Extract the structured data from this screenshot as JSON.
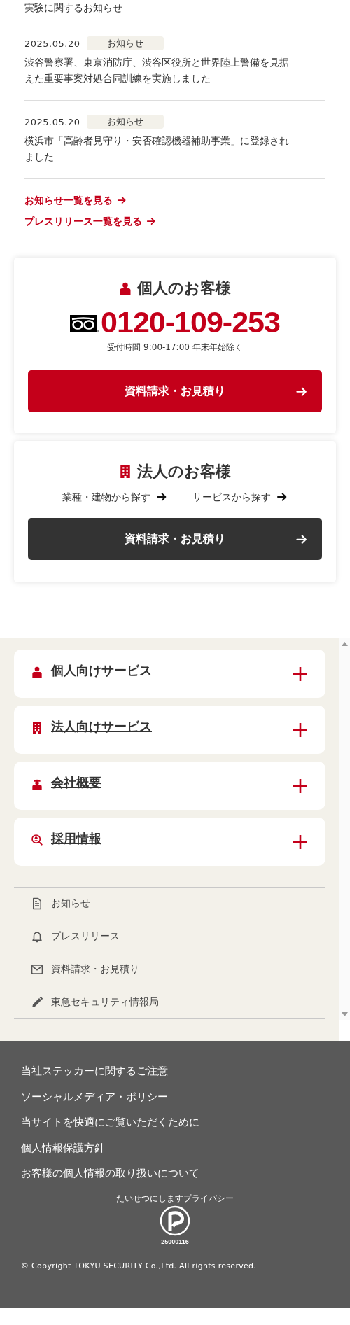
{
  "news": {
    "cut_item": "実験に関するお知らせ",
    "items": [
      {
        "date": "2025.05.20",
        "category": "お知らせ",
        "title": "渋谷警察署、東京消防庁、渋谷区役所と世界陸上警備を見据えた重要事案対処合同訓練を実施しました"
      },
      {
        "date": "2025.05.20",
        "category": "お知らせ",
        "title": "横浜市「高齢者見守り・安否確認機器補助事業」に登録されました"
      }
    ],
    "links": [
      "お知らせ一覧を見る",
      "プレスリリース一覧を見る"
    ]
  },
  "personal_contact": {
    "title": "個人のお客様",
    "phone": "0120-109-253",
    "hours": "受付時間 9:00-17:00 年末年始除く",
    "button": "資料請求・お見積り"
  },
  "corporate_contact": {
    "title": "法人のお客様",
    "links": [
      "業種・建物から探す",
      "サービスから探す"
    ],
    "button": "資料請求・お見積り"
  },
  "accordion": [
    {
      "label": "個人向けサービス",
      "kind": "person",
      "expanded": false,
      "underlined": false
    },
    {
      "label": "法人向けサービス",
      "kind": "building",
      "expanded": false,
      "underlined": true
    },
    {
      "label": "会社概要",
      "kind": "guard",
      "expanded": false,
      "underlined": true
    },
    {
      "label": "採用情報",
      "kind": "recruit",
      "expanded": false,
      "underlined": true
    }
  ],
  "nav_links": [
    {
      "label": "お知らせ",
      "kind": "document"
    },
    {
      "label": "プレスリリース",
      "kind": "bell"
    },
    {
      "label": "資料請求・お見積り",
      "kind": "mail"
    },
    {
      "label": "東急セキュリティ情報局",
      "kind": "pencil"
    }
  ],
  "footer": {
    "links": [
      "当社ステッカーに関するご注意",
      "ソーシャルメディア・ポリシー",
      "当サイトを快適にご覧いただくために",
      "個人情報保護方針",
      "お客様の個人情報の取り扱いについて"
    ],
    "privacy_mark": {
      "caption": "たいせつにしますプライバシー",
      "number": "25000116"
    },
    "copyright": "© Copyright TOKYU SECURITY Co.,Ltd. All rights reserved."
  }
}
